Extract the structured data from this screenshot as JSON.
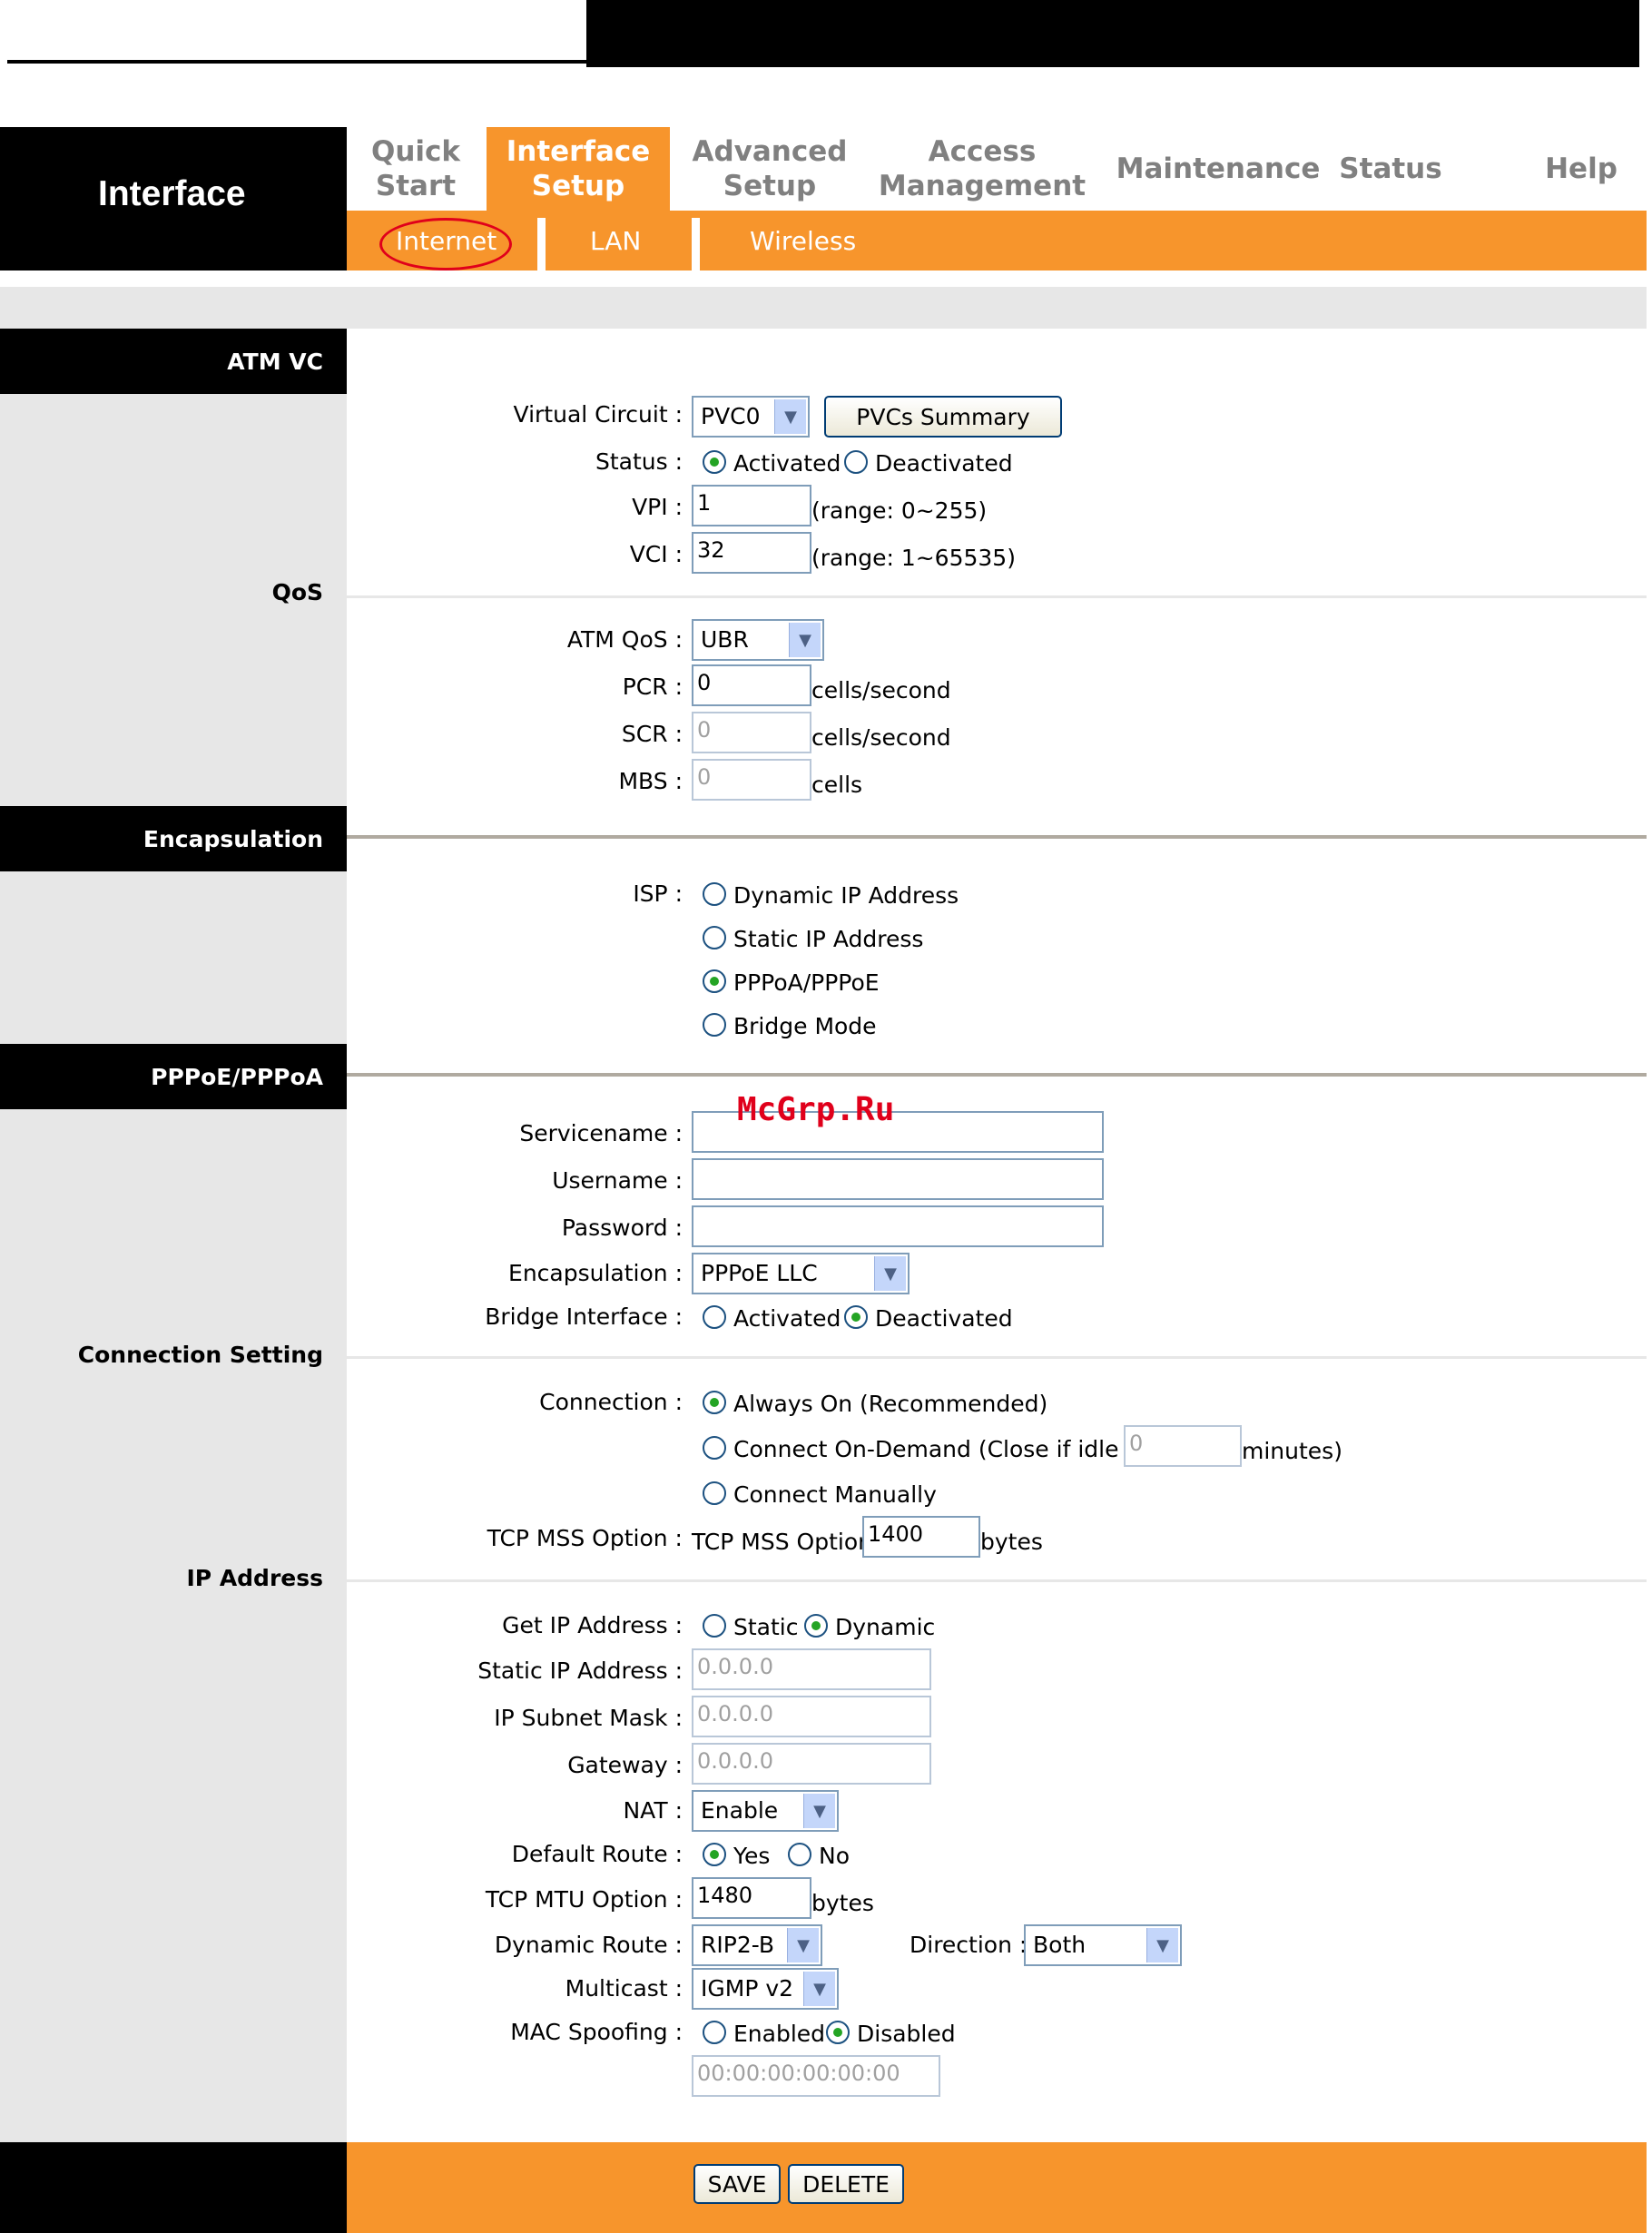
{
  "header": {
    "title": "Interface",
    "nav": [
      {
        "label": "Quick\nStart"
      },
      {
        "label": "Interface\nSetup",
        "active": true
      },
      {
        "label": "Advanced\nSetup"
      },
      {
        "label": "Access\nManagement"
      },
      {
        "label": "Maintenance"
      },
      {
        "label": "Status"
      },
      {
        "label": "Help"
      }
    ],
    "subnav": [
      "Internet",
      "LAN",
      "Wireless"
    ]
  },
  "sections": {
    "atm_vc": "ATM VC",
    "qos": "QoS",
    "encapsulation": "Encapsulation",
    "pppoe": "PPPoE/PPPoA",
    "connection": "Connection Setting",
    "ip": "IP Address"
  },
  "atm": {
    "vc_label": "Virtual Circuit :",
    "vc_value": "PVC0",
    "pvcs_button": "PVCs Summary",
    "status_label": "Status :",
    "activated": "Activated",
    "deactivated": "Deactivated",
    "vpi_label": "VPI :",
    "vpi_value": "1",
    "vpi_range": "(range: 0~255)",
    "vci_label": "VCI :",
    "vci_value": "32",
    "vci_range": "(range: 1~65535)"
  },
  "qos": {
    "atm_qos_label": "ATM QoS :",
    "atm_qos_value": "UBR",
    "pcr_label": "PCR :",
    "pcr_value": "0",
    "scr_label": "SCR :",
    "scr_value": "0",
    "mbs_label": "MBS :",
    "mbs_value": "0",
    "cells_per_second": "cells/second",
    "cells": "cells"
  },
  "encap": {
    "isp_label": "ISP :",
    "options": [
      "Dynamic IP Address",
      "Static IP Address",
      "PPPoA/PPPoE",
      "Bridge Mode"
    ]
  },
  "pppoe": {
    "servicename_label": "Servicename :",
    "username_label": "Username :",
    "password_label": "Password :",
    "encapsulation_label": "Encapsulation :",
    "encapsulation_value": "PPPoE LLC",
    "bridge_label": "Bridge Interface :",
    "activated": "Activated",
    "deactivated": "Deactivated"
  },
  "connection": {
    "label": "Connection :",
    "always_on": "Always On (Recommended)",
    "on_demand": "Connect On-Demand (Close if idle for",
    "idle_value": "0",
    "minutes": "minutes)",
    "manual": "Connect Manually",
    "tcp_mss_label": "TCP MSS Option :",
    "tcp_mss_text": "TCP MSS Option",
    "tcp_mss_value": "1400",
    "bytes": "bytes"
  },
  "ip": {
    "get_ip_label": "Get IP Address :",
    "static": "Static",
    "dynamic": "Dynamic",
    "static_ip_label": "Static IP Address :",
    "static_ip_value": "0.0.0.0",
    "subnet_label": "IP Subnet Mask :",
    "subnet_value": "0.0.0.0",
    "gateway_label": "Gateway :",
    "gateway_value": "0.0.0.0",
    "nat_label": "NAT :",
    "nat_value": "Enable",
    "default_route_label": "Default Route :",
    "yes": "Yes",
    "no": "No",
    "mtu_label": "TCP MTU Option :",
    "mtu_value": "1480",
    "bytes": "bytes",
    "dynamic_route_label": "Dynamic Route :",
    "dynamic_route_value": "RIP2-B",
    "direction_label": "Direction :",
    "direction_value": "Both",
    "multicast_label": "Multicast :",
    "multicast_value": "IGMP v2",
    "mac_label": "MAC Spoofing :",
    "enabled": "Enabled",
    "disabled": "Disabled",
    "mac_value": "00:00:00:00:00:00"
  },
  "footer": {
    "save": "SAVE",
    "delete": "DELETE"
  },
  "watermark": "McGrp.Ru",
  "colors": {
    "accent": "#f7952c",
    "panel": "#e7e7e7",
    "highlight_circle": "#e0001b"
  }
}
